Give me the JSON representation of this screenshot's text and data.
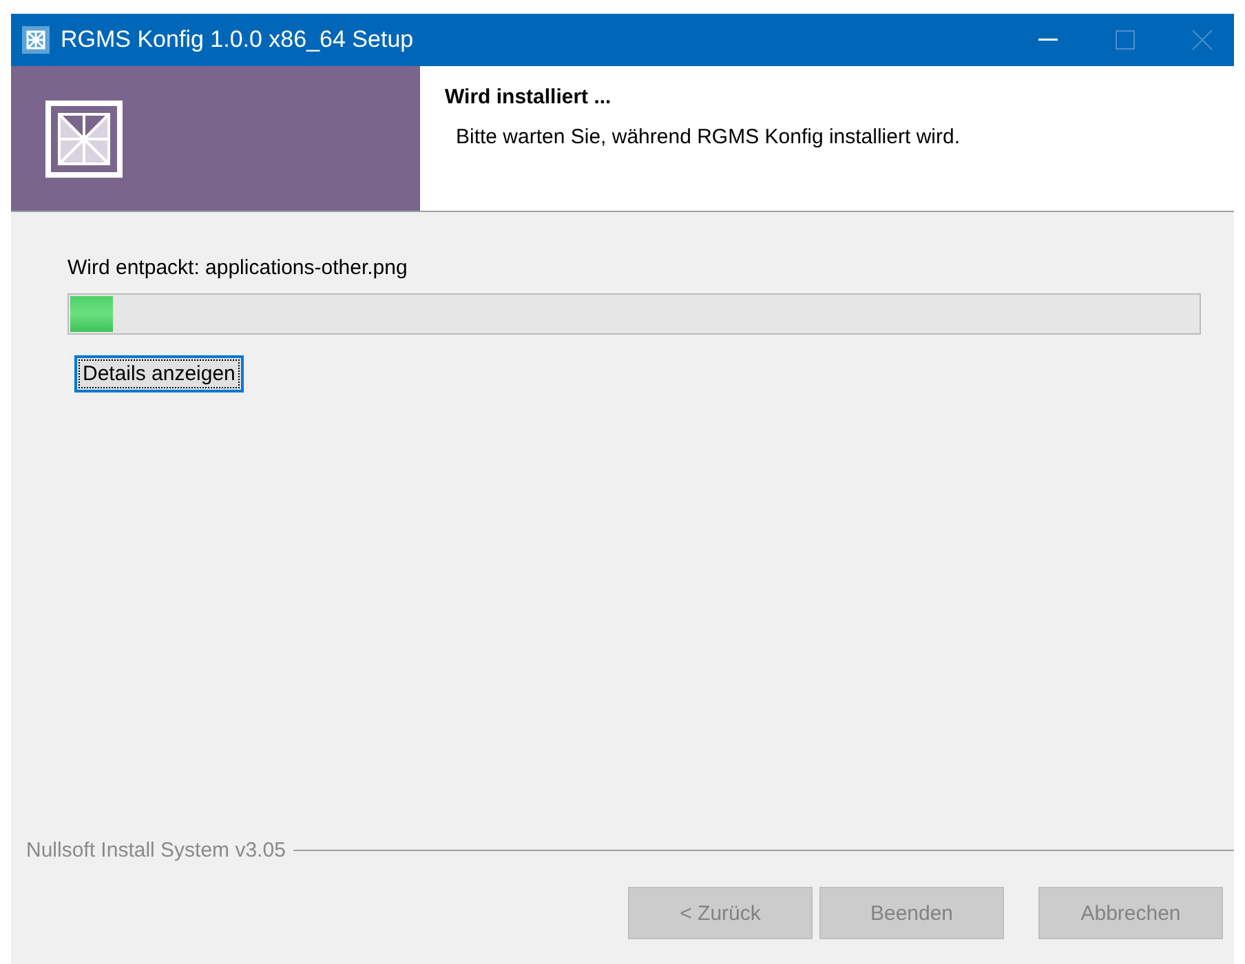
{
  "window": {
    "title": "RGMS Konfig 1.0.0 x86_64 Setup"
  },
  "header": {
    "title": "Wird installiert ...",
    "subtitle": "Bitte warten Sie, während RGMS Konfig installiert wird."
  },
  "status": "Wird entpackt: applications-other.png",
  "progress": {
    "level": 0.04
  },
  "details_button": {
    "label": "Details anzeigen",
    "focused": true
  },
  "branding": "Nullsoft Install System v3.05",
  "buttons": [
    {
      "label": "< Zurück",
      "disabled": true
    },
    {
      "label": "Beenden",
      "disabled": true
    },
    {
      "label": "Abbrechen",
      "disabled": true
    }
  ]
}
